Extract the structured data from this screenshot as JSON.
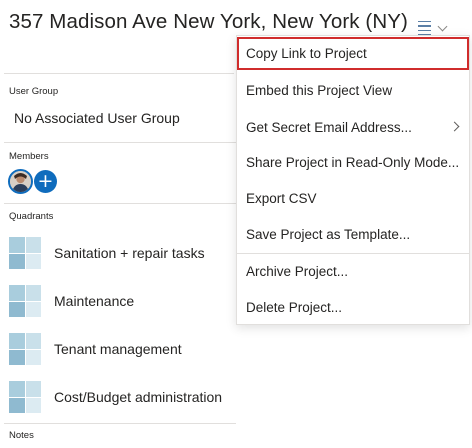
{
  "project": {
    "title": "357 Madison Ave New York, New York (NY)"
  },
  "view_toggle": {
    "icon": "list-view-icon",
    "chevron": "chevron-down-icon"
  },
  "user_group": {
    "label": "User Group",
    "value": "No Associated User Group"
  },
  "members": {
    "label": "Members",
    "add_icon": "add-member-icon"
  },
  "quadrants": {
    "label": "Quadrants",
    "items": [
      {
        "name": "Sanitation + repair tasks"
      },
      {
        "name": "Maintenance"
      },
      {
        "name": "Tenant management"
      },
      {
        "name": "Cost/Budget administration"
      }
    ],
    "colors": {
      "dark": "#8fbad0",
      "mid": "#b8d6e3",
      "light": "#dcebf2",
      "accent": "#a9cddd"
    }
  },
  "notes": {
    "label": "Notes"
  },
  "menu": {
    "items": [
      {
        "label": "Copy Link to Project",
        "highlighted": true
      },
      {
        "label": "Embed this Project View"
      },
      {
        "label": "Get Secret Email Address...",
        "has_submenu": true
      },
      {
        "label": "Share Project in Read-Only Mode..."
      },
      {
        "label": "Export CSV"
      },
      {
        "label": "Save Project as Template..."
      },
      {
        "label": "Archive Project..."
      },
      {
        "label": "Delete Project..."
      }
    ]
  },
  "colors": {
    "accent": "#0f6cbd",
    "highlight_border": "#d02c2c",
    "divider": "#e1dfdd",
    "text": "#252423"
  }
}
